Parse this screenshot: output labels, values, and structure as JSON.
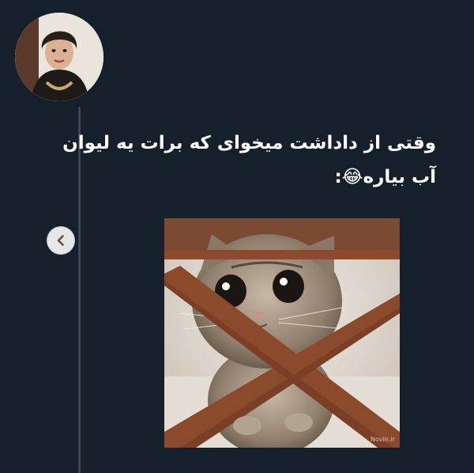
{
  "tweet": {
    "line1": "وقتی از داداشت میخوای که برات یه لیوان",
    "line2": "آب بیاره😂:"
  },
  "image": {
    "watermark": "Novin.ir"
  },
  "icons": {
    "back": "chevron-left-icon",
    "avatar": "avatar"
  },
  "colors": {
    "background": "#15202b",
    "text": "#ffffff",
    "thread_line": "#3a4656",
    "back_button": "#e6e6e6"
  }
}
